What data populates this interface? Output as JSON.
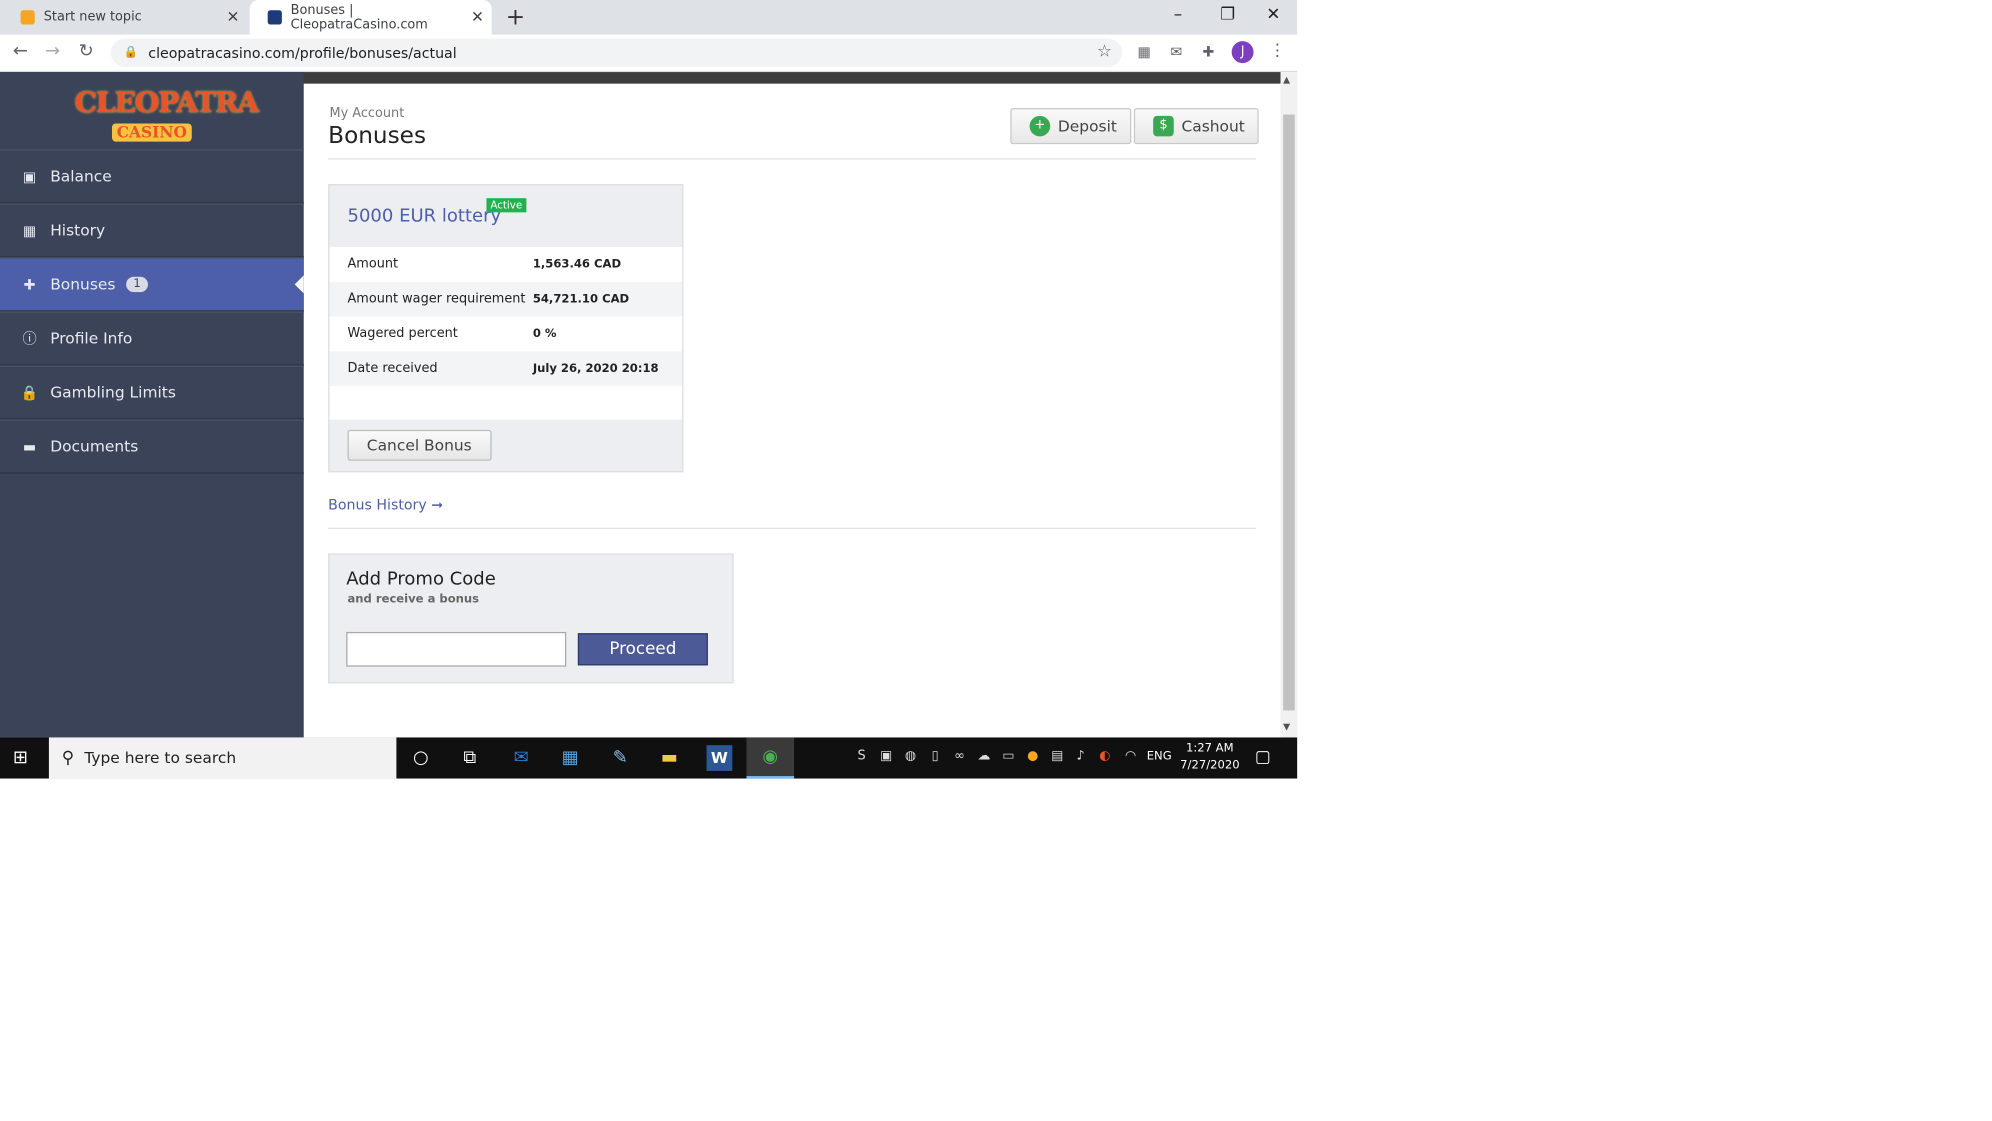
{
  "browser": {
    "tabs": [
      {
        "label": "Start new topic"
      },
      {
        "label": "Bonuses | CleopatraCasino.com"
      }
    ],
    "url": "cleopatracasino.com/profile/bonuses/actual",
    "profile_initial": "J"
  },
  "logo": {
    "line1": "CLEOPATRA",
    "line2": "CASINO"
  },
  "sidebar": {
    "items": [
      {
        "label": "Balance",
        "icon": "money-icon"
      },
      {
        "label": "History",
        "icon": "calendar-icon"
      },
      {
        "label": "Bonuses",
        "icon": "gift-icon",
        "badge": "1",
        "active": true
      },
      {
        "label": "Profile Info",
        "icon": "info-icon"
      },
      {
        "label": "Gambling Limits",
        "icon": "lock-icon"
      },
      {
        "label": "Documents",
        "icon": "folder-icon"
      }
    ]
  },
  "header": {
    "breadcrumb": "My Account",
    "title": "Bonuses",
    "deposit_label": "Deposit",
    "cashout_label": "Cashout"
  },
  "bonus": {
    "name": "5000 EUR lottery",
    "status": "Active",
    "rows": [
      {
        "label": "Amount",
        "value": "1,563.46 CAD"
      },
      {
        "label": "Amount wager requirement",
        "value": "54,721.10 CAD"
      },
      {
        "label": "Wagered percent",
        "value": "0 %"
      },
      {
        "label": "Date received",
        "value": "July 26, 2020 20:18"
      }
    ],
    "cancel_label": "Cancel Bonus"
  },
  "bonus_history_link": "Bonus History",
  "promo": {
    "heading": "Add Promo Code",
    "subheading": "and receive a bonus",
    "input_value": "",
    "proceed_label": "Proceed"
  },
  "taskbar": {
    "search_placeholder": "Type here to search",
    "language": "ENG",
    "time": "1:27 AM",
    "date": "7/27/2020"
  },
  "colors": {
    "sidebar_bg": "#3b4358",
    "accent": "#4c5fa8",
    "active_badge": "#22b14c"
  }
}
